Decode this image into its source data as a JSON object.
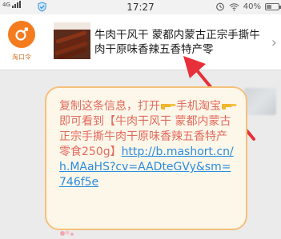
{
  "status_bar": {
    "network_label": "4G",
    "time": "17:27",
    "battery_text": "40%"
  },
  "link_card": {
    "logo_label": "淘口令",
    "title": "牛肉干风干 蒙都内蒙古正宗手撕牛肉干原味香辣五香特产零",
    "chevron": "›"
  },
  "message": {
    "part1": "复制这条信息，打开",
    "part2": "手机淘宝",
    "part3": "即可看到【牛肉干风干 蒙都内蒙古正宗手撕牛肉干原味香辣五香特产零食250g】",
    "link": "http://b.mashort.cn/h.MAaHS?cv=AADteGVy&sm=746f5e"
  },
  "colors": {
    "accent_orange": "#f57b1f",
    "message_text": "#e26a5e",
    "link": "#2a8ce0",
    "annotation_arrow": "#e8303a"
  }
}
